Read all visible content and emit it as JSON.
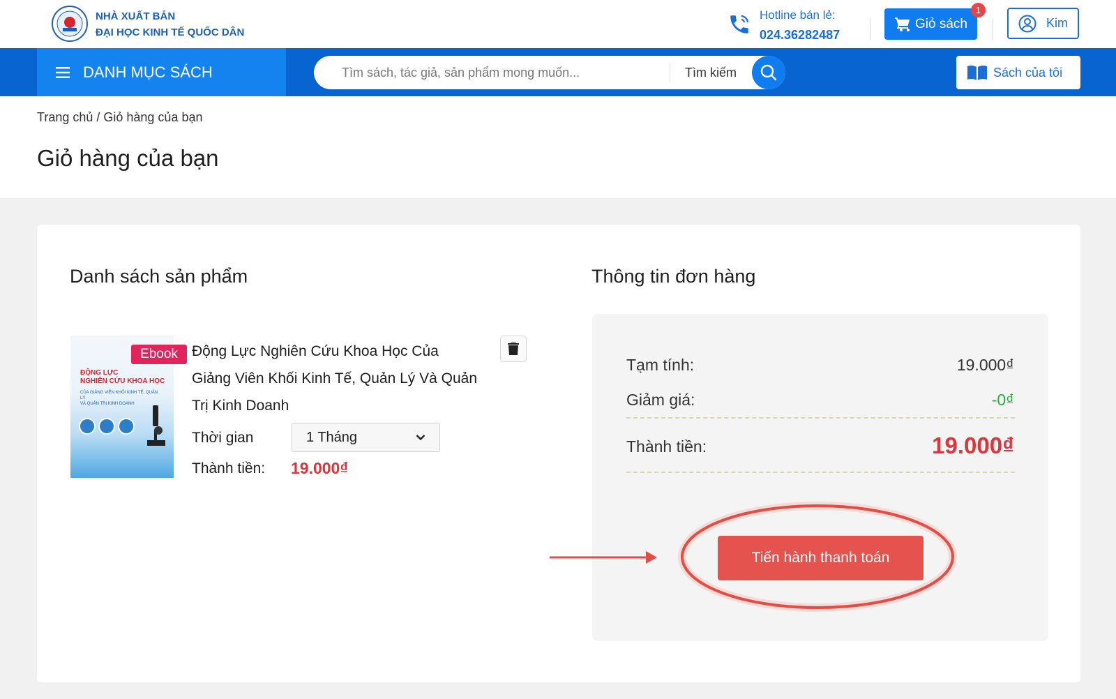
{
  "header": {
    "brand_line1": "NHÀ XUẤT BẢN",
    "brand_line2": "ĐẠI HỌC KINH TẾ QUỐC DÂN",
    "hotline_label": "Hotline bán lẻ:",
    "hotline_number": "024.36282487",
    "cart_label": "Giỏ sách",
    "cart_count": "1",
    "user_name": "Kim"
  },
  "nav": {
    "category_label": "DANH MỤC SÁCH",
    "search_placeholder": "Tìm sách, tác giả, sản phẩm mong muốn...",
    "search_label": "Tìm kiếm",
    "my_books_label": "Sách của tôi"
  },
  "page": {
    "breadcrumb": "Trang chủ / Giỏ hàng của bạn",
    "title": "Giỏ hàng của bạn"
  },
  "products": {
    "section_title": "Danh sách sản phẩm",
    "items": [
      {
        "badge": "Ebook",
        "name": "Động Lực Nghiên Cứu Khoa Học Của Giảng Viên Khối Kinh Tế, Quản Lý Và Quản Trị Kinh Doanh",
        "time_label": "Thời gian",
        "time_value": "1 Tháng",
        "total_label": "Thành tiền:",
        "total_value": "19.000₫"
      }
    ]
  },
  "order": {
    "section_title": "Thông tin đơn hàng",
    "subtotal_label": "Tạm tính:",
    "subtotal_value": "19.000₫",
    "discount_label": "Giảm giá:",
    "discount_value": "-0₫",
    "total_label": "Thành tiền:",
    "total_value": "19.000₫",
    "checkout_label": "Tiến hành thanh toán"
  },
  "colors": {
    "brand_blue": "#0864d1",
    "accent_blue": "#0f7cf0",
    "price_red": "#d9363e",
    "discount_green": "#2eaa3c",
    "checkout_red": "#e5534e",
    "annotation_red": "#e14d47"
  },
  "icons": [
    "logo-seal-icon",
    "phone-icon",
    "cart-icon",
    "user-icon",
    "menu-icon",
    "search-icon",
    "book-icon",
    "trash-icon",
    "chevron-down-icon"
  ]
}
